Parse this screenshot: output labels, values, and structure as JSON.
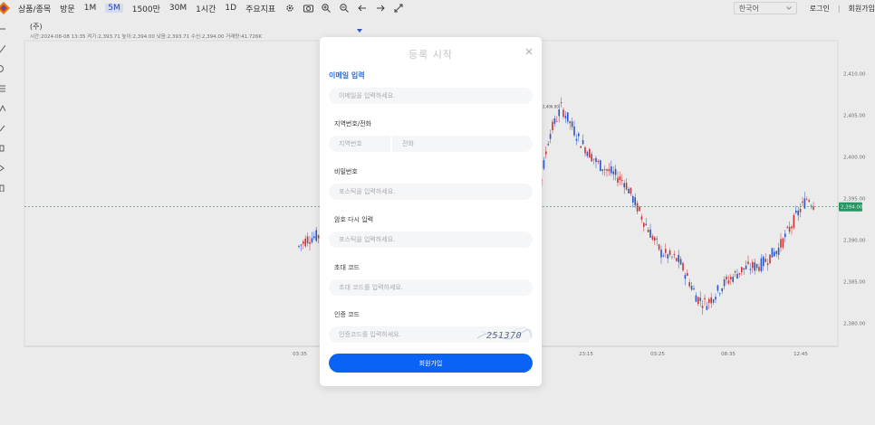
{
  "toolbar": {
    "items": [
      "상품/종목",
      "방문",
      "1M",
      "5M",
      "1500만",
      "30M",
      "1시간",
      "1D",
      "주요지표"
    ],
    "active": "5M",
    "language": "한국어",
    "login": "로그인",
    "signup": "회원가입"
  },
  "chart_header": {
    "title": "(주)",
    "stats": "시간:2024-08-08 13:35   켜기:2,393.71   높이:2,394.00   낮음:2,393.71   수신:2,394.00   거래량:41.726K"
  },
  "chart_data": {
    "type": "candlestick",
    "x_ticks": [
      "03:35",
      "23:15",
      "03:25",
      "08:35",
      "12:45"
    ],
    "y_ticks": [
      2410.0,
      2405.0,
      2400.0,
      2395.0,
      2390.0,
      2385.0,
      2380.0
    ],
    "y_tick_labels": [
      "2,410.00",
      "2,405.00",
      "2,400.00",
      "2,395.00",
      "2,390.00",
      "2,385.00",
      "2,380.00"
    ],
    "ylim": [
      2377.2,
      2414.0
    ],
    "current_price": 2394.0,
    "current_price_label": "2,394.00",
    "peak_label": "2,406.00",
    "colors": {
      "up": "#2e5fd6",
      "down": "#d8393b",
      "price_line": "#2aa36b"
    }
  },
  "modal": {
    "title": "등록 시작",
    "email_label": "이메일 입력",
    "email_placeholder": "이메일을 입력하세요.",
    "phone_label": "지역번호/전화",
    "area_placeholder": "지역번호",
    "phone_placeholder": "전화",
    "password_label": "비밀번호",
    "password_placeholder": "포스틱을 입력하세요.",
    "password2_label": "암호 다시 입력",
    "password2_placeholder": "포스틱을 입력하세요.",
    "invite_label": "초대 코드",
    "invite_placeholder": "초대 코드를 입력하세요.",
    "verify_label": "인증 코드",
    "verify_placeholder": "인증코드를 입력하세요.",
    "captcha_text": "251370",
    "submit_label": "회원가입"
  }
}
